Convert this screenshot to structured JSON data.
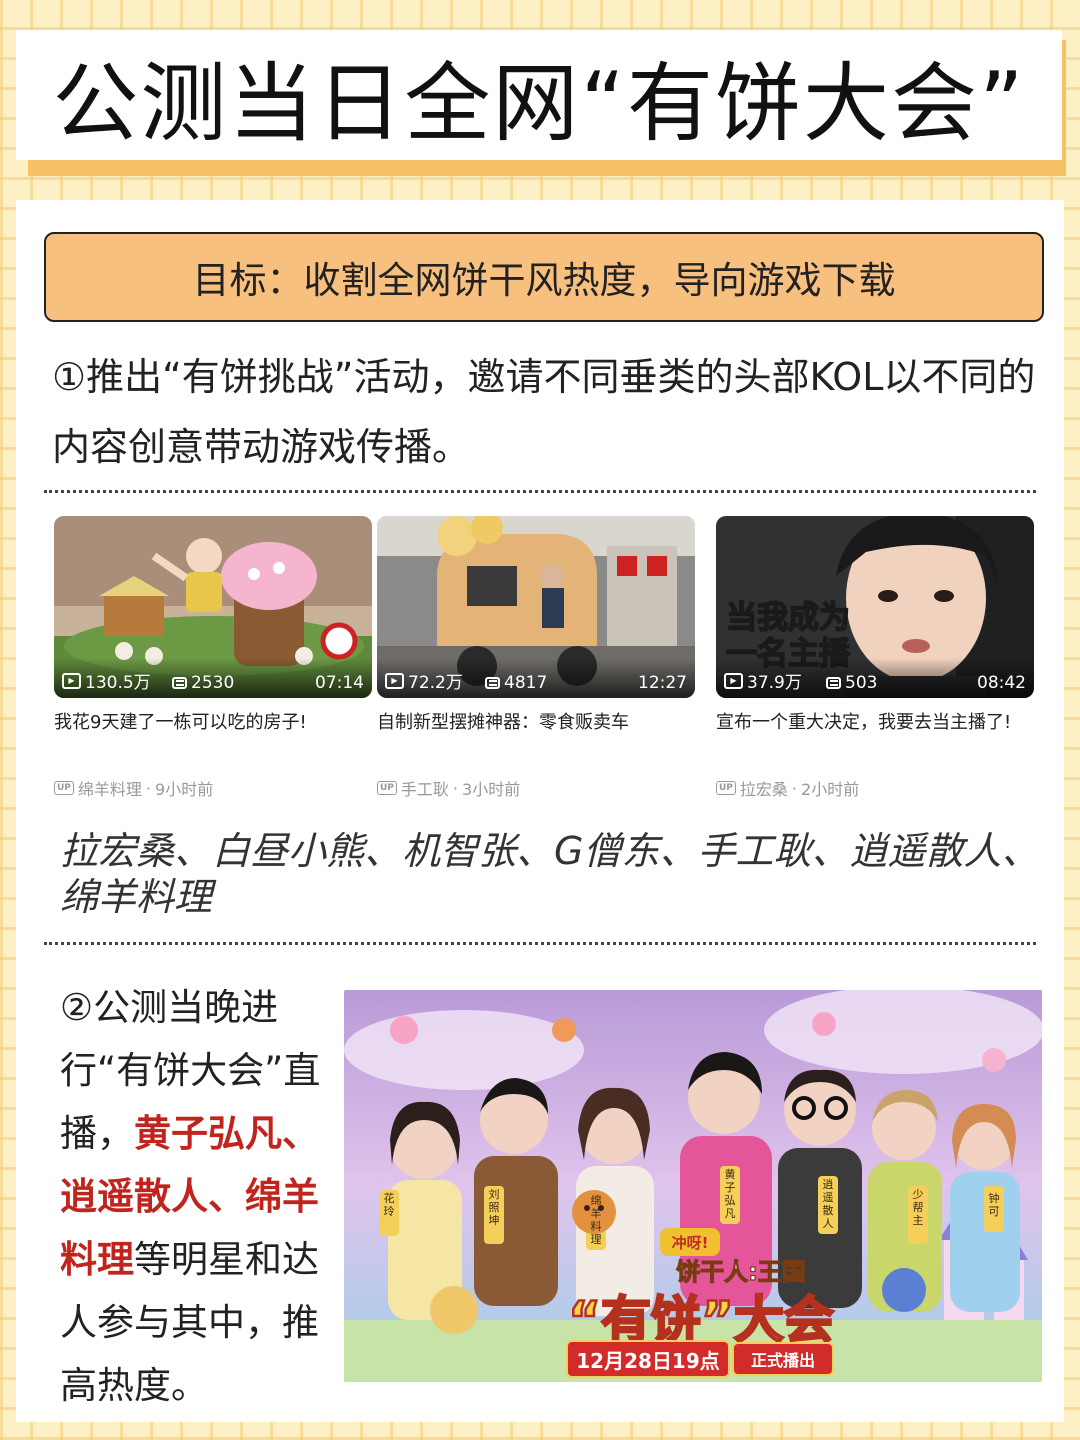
{
  "title": "公测当日全网“有饼大会”",
  "goal": "目标：收割全网饼干风热度，导向游戏下载",
  "section1": "①推出“有饼挑战”活动，邀请不同垂类的头部KOL以不同的内容创意带动游戏传播。",
  "videos": [
    {
      "views": "130.5万",
      "danmaku": "2530",
      "duration": "07:14",
      "title": "我花9天建了一栋可以吃的房子!",
      "author": "绵羊料理",
      "time": "9小时前"
    },
    {
      "views": "72.2万",
      "danmaku": "4817",
      "duration": "12:27",
      "title": "自制新型摆摊神器：零食贩卖车",
      "author": "手工耿",
      "time": "3小时前"
    },
    {
      "views": "37.9万",
      "danmaku": "503",
      "duration": "08:42",
      "title": "宣布一个重大决定，我要去当主播了!",
      "author": "拉宏桑",
      "time": "2小时前",
      "overlay_text": "当我成为一名主播"
    }
  ],
  "up_badge": "UP",
  "meta_sep": "·",
  "kol_list": "拉宏桑、白昼小熊、机智张、G僧东、手工耿、逍遥散人、绵羊料理",
  "section2": {
    "prefix": "②公测当晚进行“有饼大会”直播，",
    "highlight": "黄子弘凡、逍遥散人、绵羊料理",
    "suffix": "等明星和达人参与其中，推高热度。"
  },
  "banner": {
    "top_tag": "冲呀!",
    "game_name": "饼干人:王国",
    "event_name": "“有饼”大会",
    "date": "12月28日19点",
    "broadcast": "正式播出",
    "host_names": [
      "花玲",
      "刘照坤",
      "绵羊料理",
      "黄子弘凡",
      "逍遥散人",
      "少帮主",
      "钟可"
    ]
  },
  "colors": {
    "background": "#fdf0c4",
    "grid": "#f3cc78",
    "title_shadow": "#f7c266",
    "goal_fill": "#f8c07e",
    "highlight": "#c0241c",
    "banner_red": "#d32a2a"
  }
}
